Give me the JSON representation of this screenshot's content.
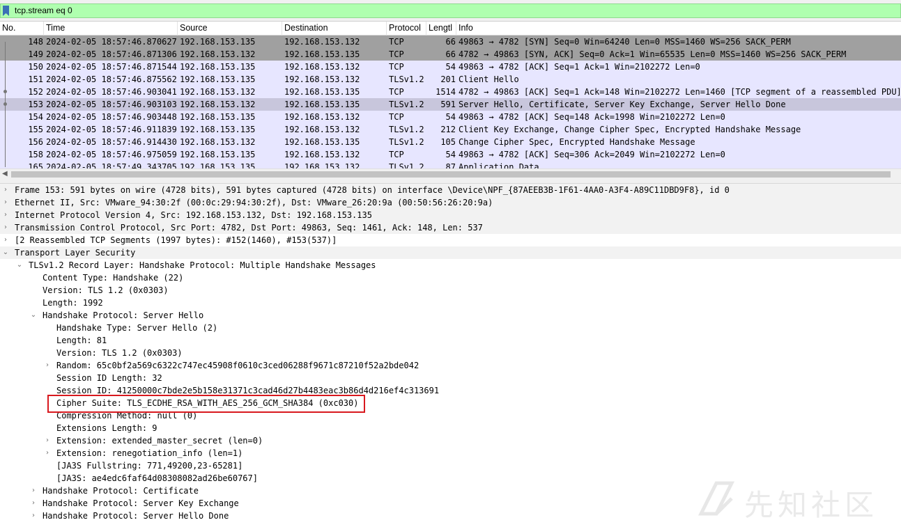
{
  "filter": {
    "value": "tcp.stream eq 0"
  },
  "columns": [
    "No.",
    "Time",
    "Source",
    "Destination",
    "Protocol",
    "Lengtl",
    "Info"
  ],
  "packets": [
    {
      "no": "148",
      "time": "2024-02-05 18:57:46.870627",
      "src": "192.168.153.135",
      "dst": "192.168.153.132",
      "proto": "TCP",
      "len": "66",
      "info": "49863 → 4782 [SYN] Seq=0 Win=64240 Len=0 MSS=1460 WS=256 SACK_PERM"
    },
    {
      "no": "149",
      "time": "2024-02-05 18:57:46.871306",
      "src": "192.168.153.132",
      "dst": "192.168.153.135",
      "proto": "TCP",
      "len": "66",
      "info": "4782 → 49863 [SYN, ACK] Seq=0 Ack=1 Win=65535 Len=0 MSS=1460 WS=256 SACK_PERM"
    },
    {
      "no": "150",
      "time": "2024-02-05 18:57:46.871544",
      "src": "192.168.153.135",
      "dst": "192.168.153.132",
      "proto": "TCP",
      "len": "54",
      "info": "49863 → 4782 [ACK] Seq=1 Ack=1 Win=2102272 Len=0"
    },
    {
      "no": "151",
      "time": "2024-02-05 18:57:46.875562",
      "src": "192.168.153.135",
      "dst": "192.168.153.132",
      "proto": "TLSv1.2",
      "len": "201",
      "info": "Client Hello"
    },
    {
      "no": "152",
      "time": "2024-02-05 18:57:46.903041",
      "src": "192.168.153.132",
      "dst": "192.168.153.135",
      "proto": "TCP",
      "len": "1514",
      "info": "4782 → 49863 [ACK] Seq=1 Ack=148 Win=2102272 Len=1460 [TCP segment of a reassembled PDU]"
    },
    {
      "no": "153",
      "time": "2024-02-05 18:57:46.903103",
      "src": "192.168.153.132",
      "dst": "192.168.153.135",
      "proto": "TLSv1.2",
      "len": "591",
      "info": "Server Hello, Certificate, Server Key Exchange, Server Hello Done"
    },
    {
      "no": "154",
      "time": "2024-02-05 18:57:46.903448",
      "src": "192.168.153.135",
      "dst": "192.168.153.132",
      "proto": "TCP",
      "len": "54",
      "info": "49863 → 4782 [ACK] Seq=148 Ack=1998 Win=2102272 Len=0"
    },
    {
      "no": "155",
      "time": "2024-02-05 18:57:46.911839",
      "src": "192.168.153.135",
      "dst": "192.168.153.132",
      "proto": "TLSv1.2",
      "len": "212",
      "info": "Client Key Exchange, Change Cipher Spec, Encrypted Handshake Message"
    },
    {
      "no": "156",
      "time": "2024-02-05 18:57:46.914430",
      "src": "192.168.153.132",
      "dst": "192.168.153.135",
      "proto": "TLSv1.2",
      "len": "105",
      "info": "Change Cipher Spec, Encrypted Handshake Message"
    },
    {
      "no": "158",
      "time": "2024-02-05 18:57:46.975059",
      "src": "192.168.153.135",
      "dst": "192.168.153.132",
      "proto": "TCP",
      "len": "54",
      "info": "49863 → 4782 [ACK] Seq=306 Ack=2049 Win=2102272 Len=0"
    },
    {
      "no": "165",
      "time": "2024-02-05 18:57:49.343705",
      "src": "192.168.153.135",
      "dst": "192.168.153.132",
      "proto": "TLSv1.2",
      "len": "87",
      "info": "Application Data"
    }
  ],
  "details": [
    {
      "text": "Frame 153: 591 bytes on wire (4728 bits), 591 bytes captured (4728 bits) on interface \\Device\\NPF_{87AEEB3B-1F61-4AA0-A3F4-A89C11DBD9F8}, id 0",
      "toggle": "›"
    },
    {
      "text": "Ethernet II, Src: VMware_94:30:2f (00:0c:29:94:30:2f), Dst: VMware_26:20:9a (00:50:56:26:20:9a)",
      "toggle": "›"
    },
    {
      "text": "Internet Protocol Version 4, Src: 192.168.153.132, Dst: 192.168.153.135",
      "toggle": "›"
    },
    {
      "text": "Transmission Control Protocol, Src Port: 4782, Dst Port: 49863, Seq: 1461, Ack: 148, Len: 537",
      "toggle": "›"
    },
    {
      "text": "[2 Reassembled TCP Segments (1997 bytes): #152(1460), #153(537)]",
      "toggle": "›"
    },
    {
      "text": "Transport Layer Security",
      "toggle": "⌄"
    },
    {
      "text": "TLSv1.2 Record Layer: Handshake Protocol: Multiple Handshake Messages",
      "toggle": "⌄"
    },
    {
      "text": "Content Type: Handshake (22)",
      "toggle": ""
    },
    {
      "text": "Version: TLS 1.2 (0x0303)",
      "toggle": ""
    },
    {
      "text": "Length: 1992",
      "toggle": ""
    },
    {
      "text": "Handshake Protocol: Server Hello",
      "toggle": "⌄"
    },
    {
      "text": "Handshake Type: Server Hello (2)",
      "toggle": ""
    },
    {
      "text": "Length: 81",
      "toggle": ""
    },
    {
      "text": "Version: TLS 1.2 (0x0303)",
      "toggle": ""
    },
    {
      "text": "Random: 65c0bf2a569c6322c747ec45908f0610c3ced06288f9671c87210f52a2bde042",
      "toggle": "›"
    },
    {
      "text": "Session ID Length: 32",
      "toggle": ""
    },
    {
      "text": "Session ID: 41250000c7bde2e5b158e31371c3cad46d27b4483eac3b86d4d216ef4c313691",
      "toggle": ""
    },
    {
      "text": "Cipher Suite: TLS_ECDHE_RSA_WITH_AES_256_GCM_SHA384 (0xc030)",
      "toggle": ""
    },
    {
      "text": "Compression Method: null (0)",
      "toggle": ""
    },
    {
      "text": "Extensions Length: 9",
      "toggle": ""
    },
    {
      "text": "Extension: extended_master_secret (len=0)",
      "toggle": "›"
    },
    {
      "text": "Extension: renegotiation_info (len=1)",
      "toggle": "›"
    },
    {
      "text": "[JA3S Fullstring: 771,49200,23-65281]",
      "toggle": ""
    },
    {
      "text": "[JA3S: ae4edc6faf64d08308082ad26be60767]",
      "toggle": ""
    },
    {
      "text": "Handshake Protocol: Certificate",
      "toggle": "›"
    },
    {
      "text": "Handshake Protocol: Server Key Exchange",
      "toggle": "›"
    },
    {
      "text": "Handshake Protocol: Server Hello Done",
      "toggle": "›"
    }
  ],
  "watermark": {
    "text": "先知社区"
  },
  "colors": {
    "filter_valid": "#afffaf",
    "tcp_syn_row": "#a0a0a0",
    "tcp_row": "#e7e6ff",
    "selected_row": "#c8c6dc",
    "annotation_box": "#d8181e"
  }
}
